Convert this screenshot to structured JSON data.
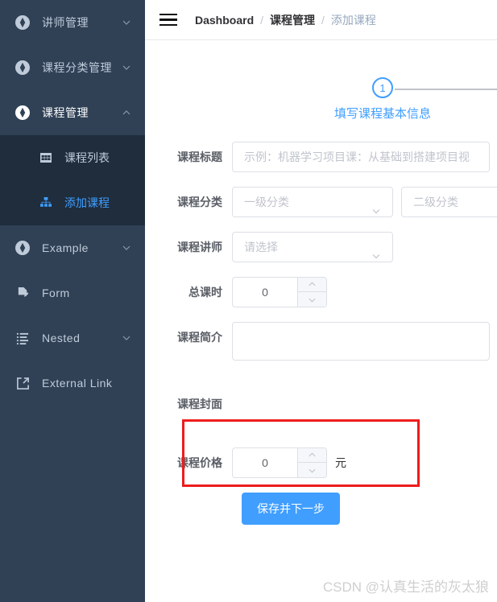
{
  "sidebar": {
    "items": [
      {
        "label": "讲师管理",
        "icon": "component-icon",
        "arrow": "chevron-down-icon",
        "expanded": false
      },
      {
        "label": "课程分类管理",
        "icon": "component-icon",
        "arrow": "chevron-down-icon",
        "expanded": false
      },
      {
        "label": "课程管理",
        "icon": "component-icon",
        "arrow": "chevron-up-icon",
        "expanded": true
      },
      {
        "label": "Example",
        "icon": "component-icon",
        "arrow": "chevron-down-icon",
        "expanded": false
      },
      {
        "label": "Form",
        "icon": "form-icon",
        "arrow": "",
        "expanded": false
      },
      {
        "label": "Nested",
        "icon": "nested-list-icon",
        "arrow": "chevron-down-icon",
        "expanded": false
      },
      {
        "label": "External Link",
        "icon": "external-link-icon",
        "arrow": "",
        "expanded": false
      }
    ],
    "submenu": [
      {
        "label": "课程列表",
        "icon": "table-icon",
        "active": false
      },
      {
        "label": "添加课程",
        "icon": "tree-icon",
        "active": true
      }
    ]
  },
  "navbar": {
    "menu_toggle": "hamburger-icon",
    "breadcrumb": [
      {
        "label": "Dashboard",
        "type": "first"
      },
      {
        "label": "课程管理",
        "type": "mid"
      },
      {
        "label": "添加课程",
        "type": "current"
      }
    ],
    "separator": "/"
  },
  "steps": {
    "current": "1",
    "title": "填写课程基本信息"
  },
  "form": {
    "title_label": "课程标题",
    "title_placeholder": "示例：机器学习项目课：从基础到搭建项目视",
    "title_value": "",
    "category_label": "课程分类",
    "category_level1_placeholder": "一级分类",
    "category_level2_placeholder": "二级分类",
    "teacher_label": "课程讲师",
    "teacher_placeholder": "请选择",
    "lessons_label": "总课时",
    "lessons_value": "0",
    "description_label": "课程简介",
    "description_value": "",
    "cover_label": "课程封面",
    "price_label": "课程价格",
    "price_value": "0",
    "price_unit": "元",
    "submit_label": "保存并下一步"
  },
  "watermark": "CSDN @认真生活的灰太狼",
  "colors": {
    "sidebar_bg": "#304156",
    "submenu_bg": "#1f2d3d",
    "accent": "#409eff",
    "annotation": "#ee1c1c",
    "text_muted": "#bfcbd9"
  }
}
